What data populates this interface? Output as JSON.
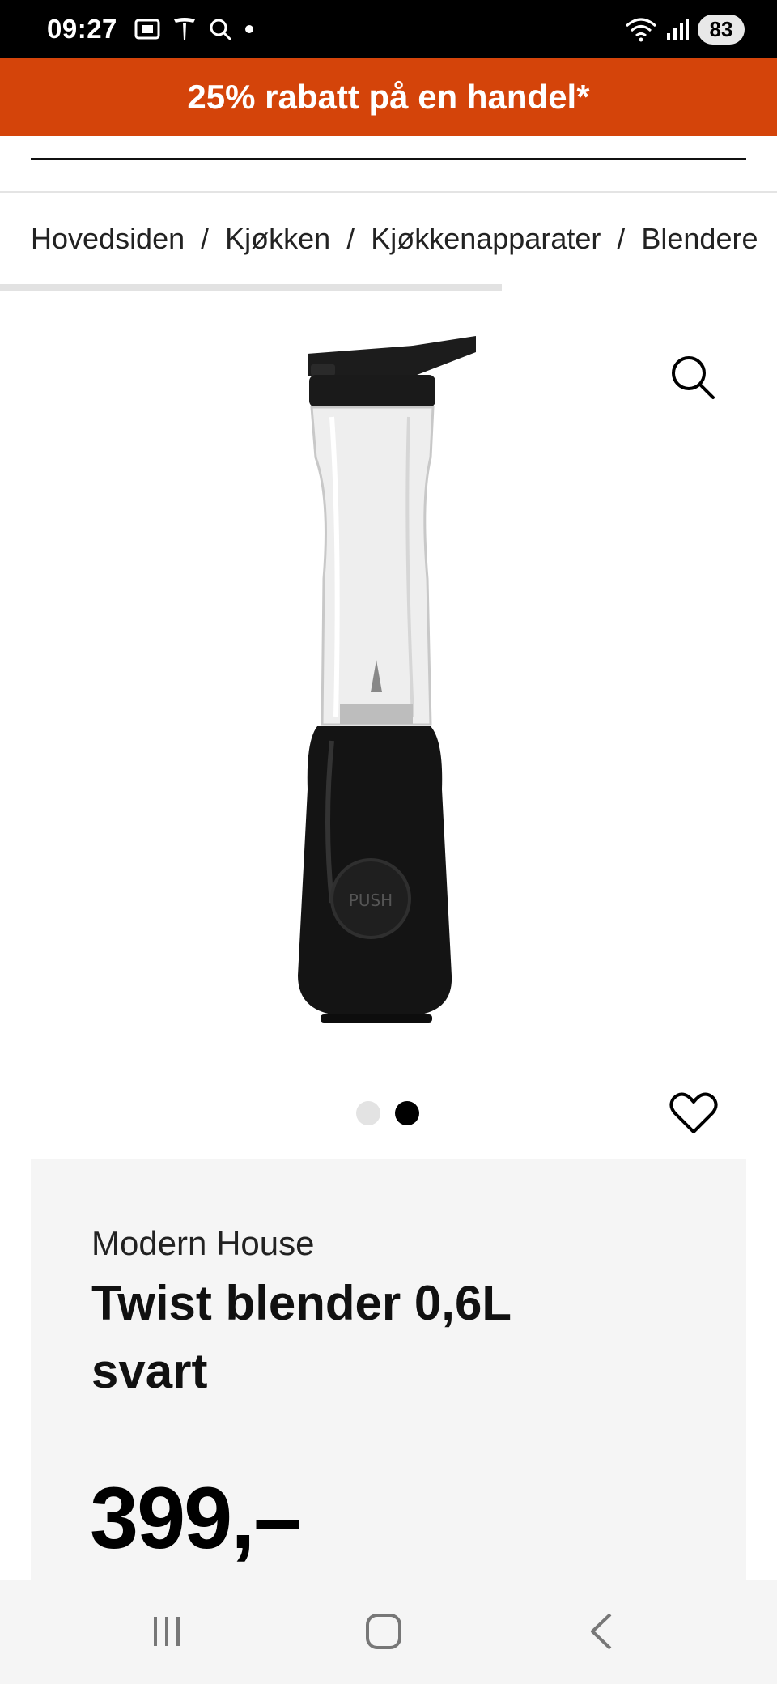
{
  "status_bar": {
    "time": "09:27",
    "battery": "83"
  },
  "promo": {
    "text": "25% rabatt på en handel*",
    "color": "#d4440a"
  },
  "breadcrumb": {
    "items": [
      {
        "label": "Hovedsiden"
      },
      {
        "label": "Kjøkken"
      },
      {
        "label": "Kjøkkenapparater"
      },
      {
        "label": "Blendere"
      }
    ],
    "separator": "/"
  },
  "gallery": {
    "image_count": 2,
    "active_index": 1,
    "product_image_button": "PUSH"
  },
  "product": {
    "brand": "Modern House",
    "title": "Twist blender 0,6L svart",
    "price": "399,–"
  },
  "icons": {
    "zoom": "magnifier-icon",
    "favorite": "heart-icon",
    "recents": "recents-icon",
    "home": "home-icon",
    "back": "back-icon"
  }
}
